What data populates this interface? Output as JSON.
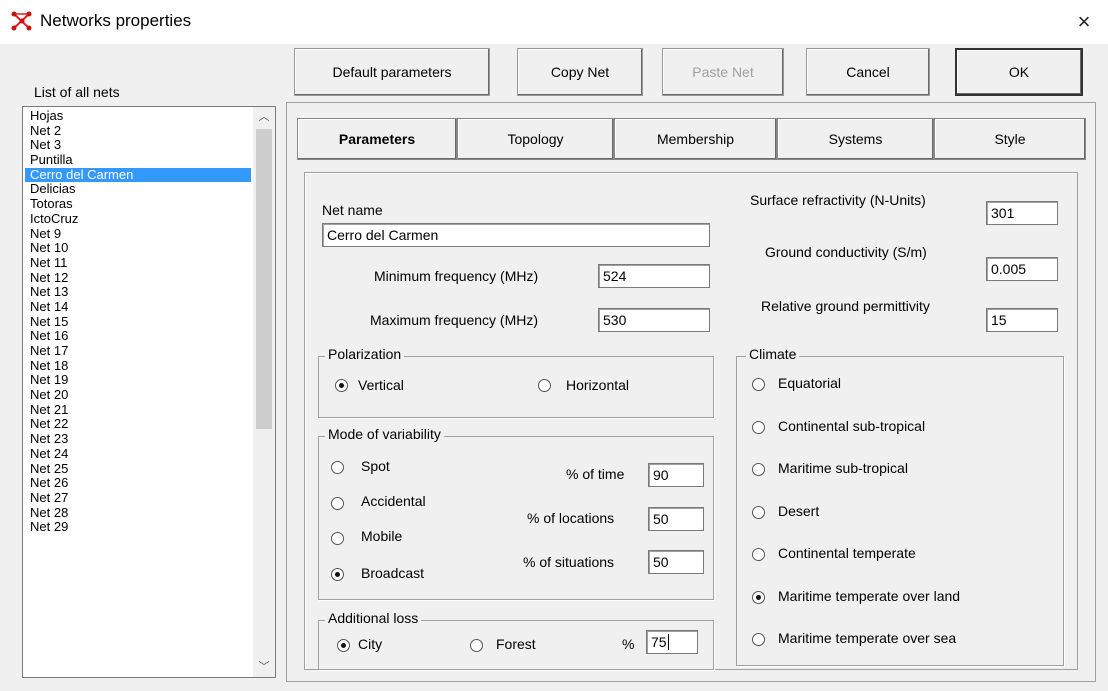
{
  "window": {
    "title": "Networks properties",
    "close_glyph": "×"
  },
  "list": {
    "caption": "List of all nets",
    "items": [
      "Hojas",
      "Net 2",
      "Net 3",
      "Puntilla",
      "Cerro del Carmen",
      "Delicias",
      "Totoras",
      "IctoCruz",
      "Net 9",
      "Net 10",
      "Net 11",
      "Net 12",
      "Net 13",
      "Net 14",
      "Net 15",
      "Net 16",
      "Net 17",
      "Net 18",
      "Net 19",
      "Net 20",
      "Net 21",
      "Net 22",
      "Net 23",
      "Net 24",
      "Net 25",
      "Net 26",
      "Net 27",
      "Net 28",
      "Net 29"
    ],
    "selected": "Cerro del Carmen"
  },
  "toolbar": {
    "default_params": "Default parameters",
    "copy_net": "Copy Net",
    "paste_net": "Paste Net",
    "cancel": "Cancel",
    "ok": "OK"
  },
  "tabs": [
    "Parameters",
    "Topology",
    "Membership",
    "Systems",
    "Style"
  ],
  "active_tab": "Parameters",
  "params": {
    "net_name_label": "Net name",
    "net_name_value": "Cerro del Carmen",
    "min_freq_label": "Minimum frequency (MHz)",
    "min_freq_value": "524",
    "max_freq_label": "Maximum frequency (MHz)",
    "max_freq_value": "530",
    "refractivity_label": "Surface refractivity (N-Units)",
    "refractivity_value": "301",
    "conductivity_label": "Ground conductivity (S/m)",
    "conductivity_value": "0.005",
    "permittivity_label": "Relative ground permittivity",
    "permittivity_value": "15"
  },
  "polarization": {
    "legend": "Polarization",
    "vertical": "Vertical",
    "horizontal": "Horizontal",
    "selected": "Vertical"
  },
  "variability": {
    "legend": "Mode of variability",
    "modes": [
      "Spot",
      "Accidental",
      "Mobile",
      "Broadcast"
    ],
    "selected": "Broadcast",
    "time_label": "% of time",
    "time_value": "90",
    "locations_label": "% of locations",
    "locations_value": "50",
    "situations_label": "% of situations",
    "situations_value": "50"
  },
  "loss": {
    "legend": "Additional loss",
    "city": "City",
    "forest": "Forest",
    "pct_label": "%",
    "pct_value": "75",
    "selected": "City"
  },
  "climate": {
    "legend": "Climate",
    "options": [
      "Equatorial",
      "Continental sub-tropical",
      "Maritime sub-tropical",
      "Desert",
      "Continental temperate",
      "Maritime temperate over land",
      "Maritime temperate over sea"
    ],
    "selected": "Maritime temperate over land"
  },
  "icons": {
    "app": "network-graph-icon",
    "scroll_up": "chevron-up-icon",
    "scroll_down": "chevron-down-icon"
  }
}
